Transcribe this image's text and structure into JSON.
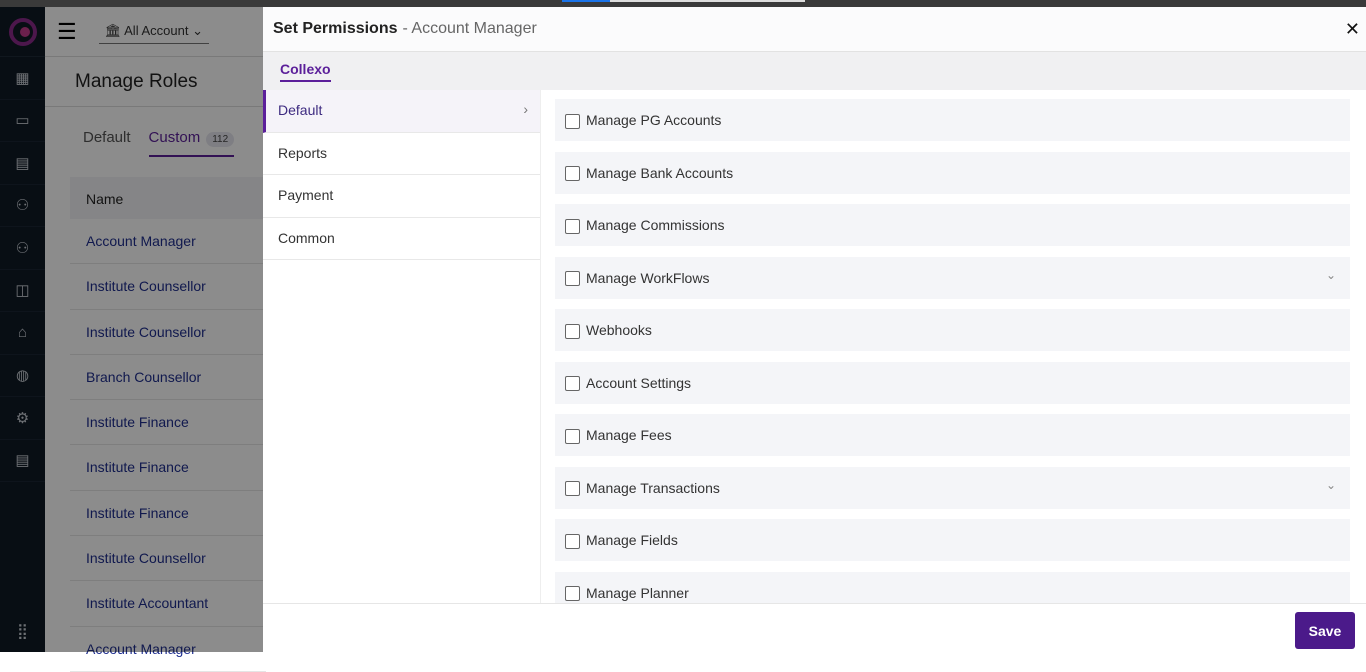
{
  "header": {
    "account_selector": "All Account",
    "page_title": "Manage Roles"
  },
  "tabs": [
    {
      "label": "Default"
    },
    {
      "label": "Custom",
      "count": "112"
    }
  ],
  "table": {
    "header": "Name",
    "rows": [
      "Account Manager",
      "Institute Counsellor",
      "Institute Counsellor",
      "Branch Counsellor",
      "Institute Finance",
      "Institute Finance",
      "Institute Finance",
      "Institute Counsellor",
      "Institute Accountant",
      "Account Manager"
    ]
  },
  "modal": {
    "title": "Set Permissions",
    "role": "- Account Manager",
    "org_tab": "Collexo",
    "categories": [
      "Default",
      "Reports",
      "Payment",
      "Common"
    ],
    "permissions": [
      {
        "label": "Manage PG Accounts"
      },
      {
        "label": "Manage Bank Accounts"
      },
      {
        "label": "Manage Commissions"
      },
      {
        "label": "Manage WorkFlows",
        "expandable": true
      },
      {
        "label": "Webhooks"
      },
      {
        "label": "Account Settings"
      },
      {
        "label": "Manage Fees"
      },
      {
        "label": "Manage Transactions",
        "expandable": true
      },
      {
        "label": "Manage Fields"
      },
      {
        "label": "Manage Planner"
      }
    ],
    "save_label": "Save"
  },
  "colors": {
    "accent": "#5b1f9a",
    "sidebar": "#0f1a26"
  }
}
